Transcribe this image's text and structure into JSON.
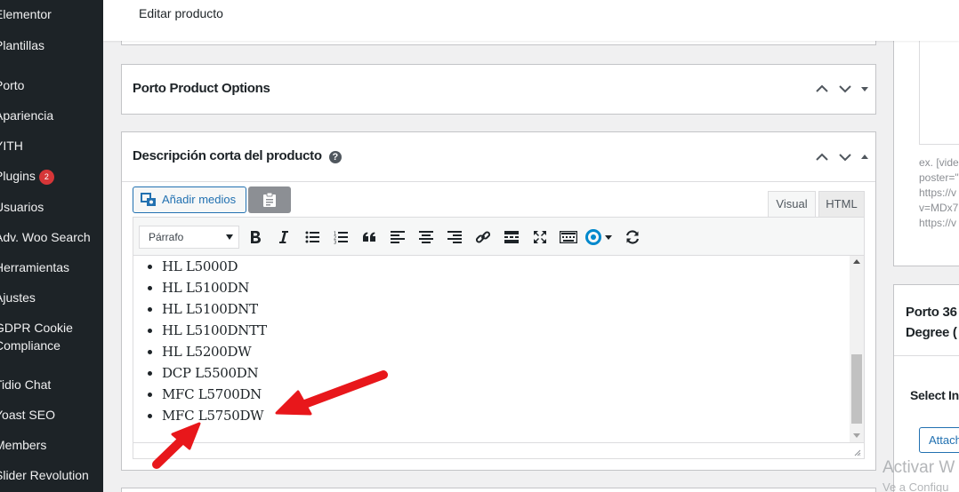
{
  "sidebar": {
    "items": [
      {
        "label": "Elementor"
      },
      {
        "label": "Plantillas"
      },
      {
        "label": "Porto"
      },
      {
        "label": "Apariencia"
      },
      {
        "label": "YITH"
      },
      {
        "label": "Plugins",
        "badge": "2"
      },
      {
        "label": "Usuarios"
      },
      {
        "label": "Adv. Woo Search"
      },
      {
        "label": "Herramientas"
      },
      {
        "label": "Ajustes"
      },
      {
        "label": "GDPR Cookie"
      },
      {
        "label": "Compliance"
      },
      {
        "label": "Tidio Chat"
      },
      {
        "label": "Yoast SEO"
      },
      {
        "label": "Members"
      },
      {
        "label": "Slider Revolution"
      }
    ]
  },
  "header": {
    "title": "Editar producto"
  },
  "porto_box": {
    "title": "Porto Product Options"
  },
  "desc_box": {
    "title": "Descripción corta del producto",
    "add_media": "Añadir medios",
    "tabs": {
      "visual": "Visual",
      "html": "HTML"
    },
    "format_select": "Párrafo",
    "items": [
      "HL L5000D",
      "HL L5100DN",
      "HL L5100DNT",
      "HL L5100DNTT",
      "HL L5200DW",
      "DCP L5500DN",
      "MFC L5700DN",
      "MFC L5750DW"
    ]
  },
  "right": {
    "hint_lines": [
      "ex. [video",
      "poster=\"",
      "https://v",
      "v=MDx7l",
      "https://v"
    ],
    "box_title_1": "Porto 36",
    "box_title_2": "Degree (",
    "select_label": "Select In",
    "attach_label": "Attach"
  },
  "watermark": {
    "line1": "Activar W",
    "line2": "Ve a Configu"
  },
  "colors": {
    "accent": "#2271b1",
    "sidebar": "#1d2327",
    "badge": "#d63638",
    "arrow": "#e8171b"
  }
}
